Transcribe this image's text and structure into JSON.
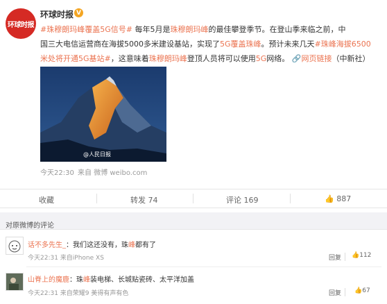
{
  "post": {
    "avatar_text": "环球时报",
    "author": "环球时报",
    "text_lines": [
      [
        "#珠穆朗玛峰覆盖5G信号#",
        " 每年5月是",
        "珠穆朗玛峰",
        "的最佳攀登季节。在登山季来临之前，中"
      ],
      [
        "国三大电信运营商在海拔5000多米建设基站，实现了",
        "5G覆盖珠峰",
        "。预计未来几天",
        "#珠峰海拔6500"
      ],
      [
        "米处将开通5G基站#",
        "，这意味着",
        "珠穆朗玛峰",
        "登顶人员将可以使用",
        "5G",
        "网络。",
        "网页链接",
        "（中新社）"
      ]
    ],
    "watermark": "@人民日报",
    "time": "今天22:30",
    "source": "来自 微博 weibo.com"
  },
  "actions": {
    "favorite": "收藏",
    "repost": "转发 74",
    "comment": "评论 169",
    "like": "887"
  },
  "comments_section": {
    "title": "对原微博的评论",
    "items": [
      {
        "name": "话不多先生_",
        "colon": "：",
        "text_before": "我们这还没有，珠",
        "text_hl": "峰",
        "text_after": "都有了",
        "meta": "今天22:31 来自iPhone XS",
        "reply": "回复",
        "likes": "112"
      },
      {
        "name": "山脊上的魔鹿",
        "colon": "：",
        "text_before": "珠",
        "text_hl": "峰",
        "text_after": "装电梯、长城贴瓷砖、太平洋加盖",
        "meta": "今天22:31 来自荣耀9 美得有声有色",
        "reply": "回复",
        "likes": "67"
      }
    ]
  }
}
